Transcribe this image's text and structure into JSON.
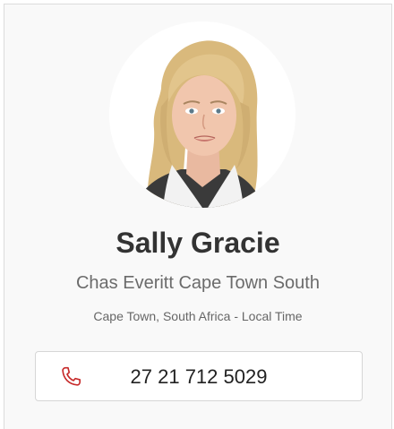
{
  "agent": {
    "name": "Sally Gracie",
    "agency": "Chas Everitt Cape Town South",
    "location": "Cape Town, South Africa - Local Time",
    "phone": "27 21 712 5029"
  },
  "icons": {
    "phone": "phone-icon",
    "photo": "agent-photo"
  },
  "colors": {
    "accent": "#c62828",
    "card_bg": "#f9f9f9",
    "border": "#d6d6d6",
    "name_text": "#333333"
  }
}
